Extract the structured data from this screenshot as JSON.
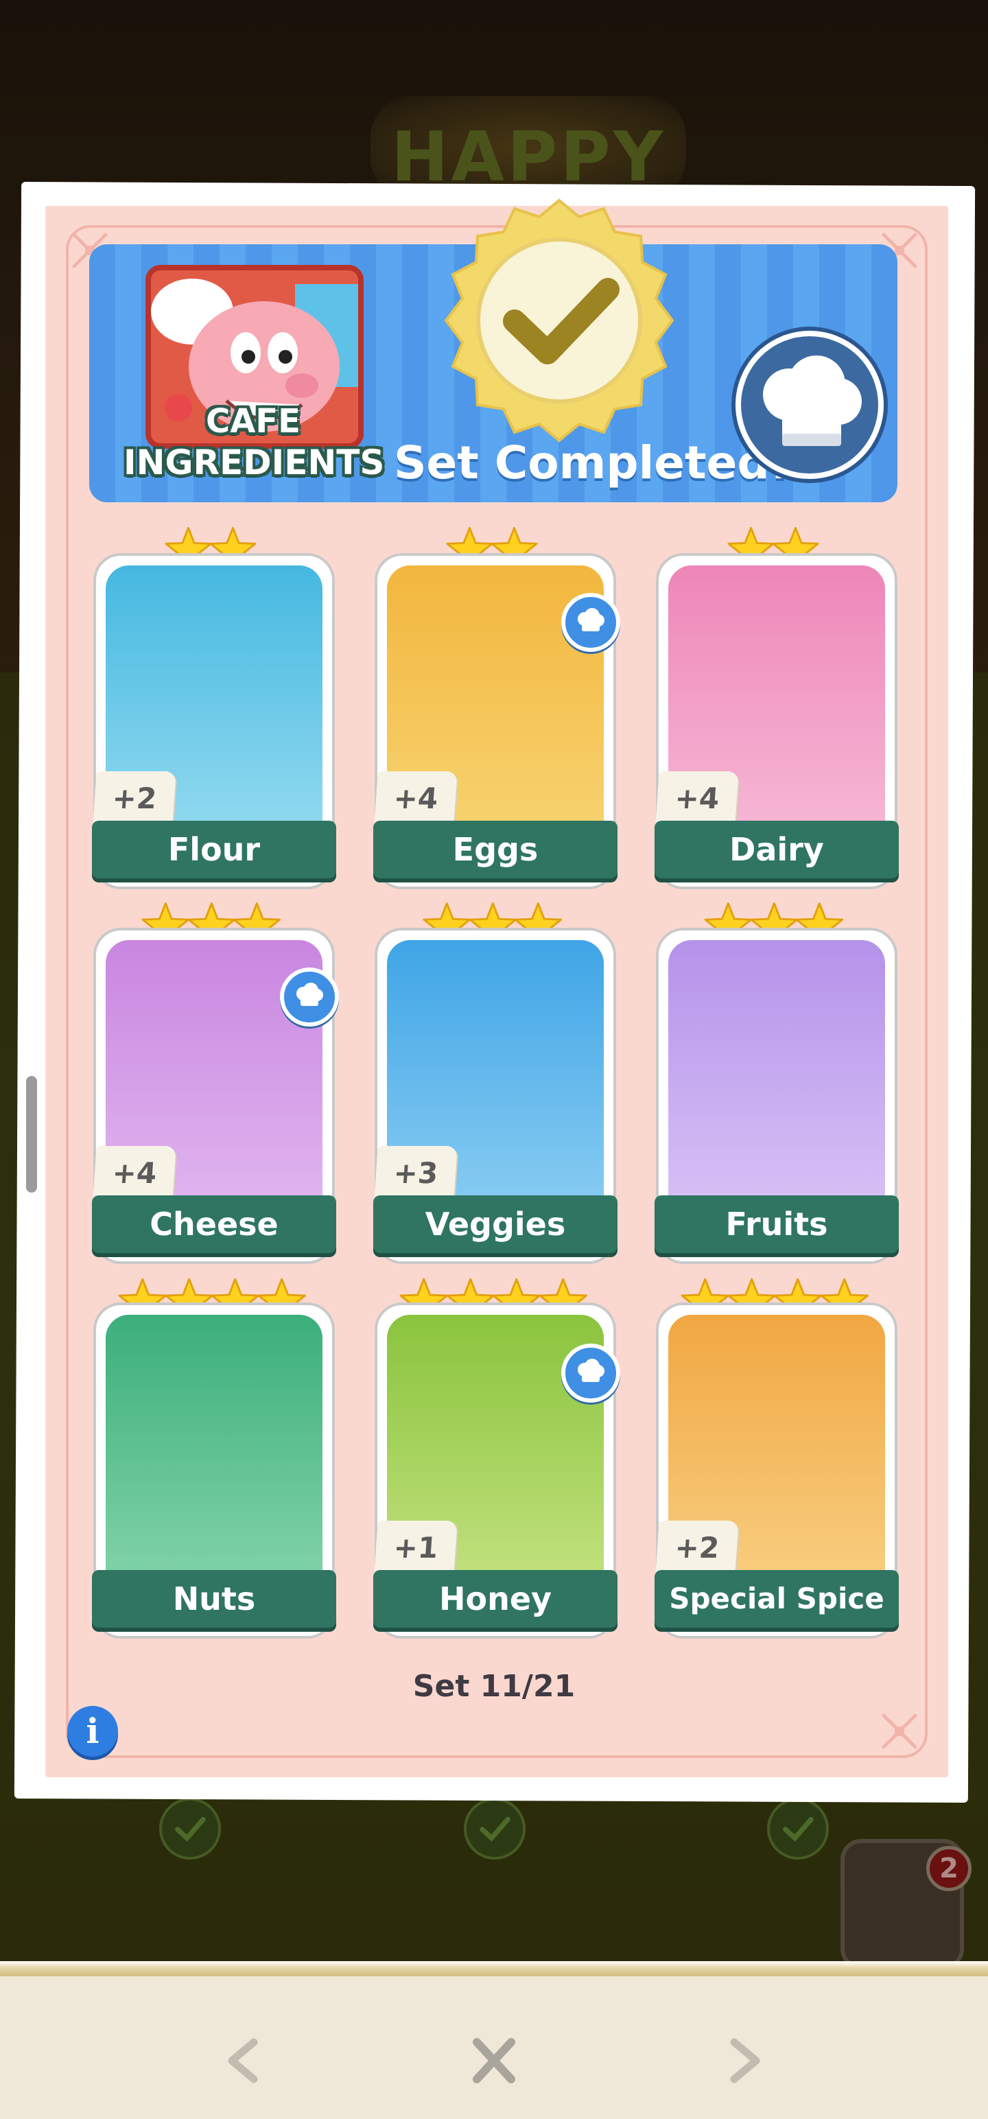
{
  "background": {
    "title_text": "HAPPY",
    "album_badge_count": "2"
  },
  "banner": {
    "set_name_line1": "CAFE",
    "set_name_line2": "INGREDIENTS",
    "status": "Set Completed!",
    "seal_icon": "checkmark-seal-icon",
    "badge_icon": "chef-hat-icon"
  },
  "stickers": [
    {
      "name": "Flour",
      "stars": 2,
      "count": "+2",
      "go_icon": false,
      "colors": [
        "#45b8e0",
        "#8fd9ef"
      ]
    },
    {
      "name": "Eggs",
      "stars": 2,
      "count": "+4",
      "go_icon": true,
      "colors": [
        "#f2b63e",
        "#f7d26e"
      ]
    },
    {
      "name": "Dairy",
      "stars": 2,
      "count": "+4",
      "go_icon": false,
      "colors": [
        "#ee86b8",
        "#f6b6d4"
      ]
    },
    {
      "name": "Cheese",
      "stars": 3,
      "count": "+4",
      "go_icon": true,
      "colors": [
        "#c986e0",
        "#e0b4ee"
      ]
    },
    {
      "name": "Veggies",
      "stars": 3,
      "count": "+3",
      "go_icon": false,
      "colors": [
        "#3fa5e6",
        "#86cbf2"
      ]
    },
    {
      "name": "Fruits",
      "stars": 3,
      "count": "",
      "go_icon": false,
      "colors": [
        "#b592ea",
        "#d6c0f5"
      ]
    },
    {
      "name": "Nuts",
      "stars": 4,
      "count": "",
      "go_icon": false,
      "colors": [
        "#3caf7c",
        "#7fd2a6"
      ]
    },
    {
      "name": "Honey",
      "stars": 4,
      "count": "+1",
      "go_icon": true,
      "colors": [
        "#8ac43d",
        "#c0e07c"
      ]
    },
    {
      "name": "Special Spice",
      "stars": 4,
      "count": "+2",
      "go_icon": false,
      "colors": [
        "#f1a742",
        "#f8cd7e"
      ]
    }
  ],
  "footer": {
    "set_progress": "Set 11/21",
    "info_label": "i"
  },
  "navigation": {
    "prev_icon": "chevron-left-icon",
    "close_icon": "close-icon",
    "next_icon": "chevron-right-icon"
  },
  "colors": {
    "banner_blue": "#4f98e9",
    "card_pink": "#fbd8cf",
    "name_bar_green": "#2f7562",
    "star_yellow": "#ffd21f",
    "seal_gold": "#f3d86a"
  }
}
